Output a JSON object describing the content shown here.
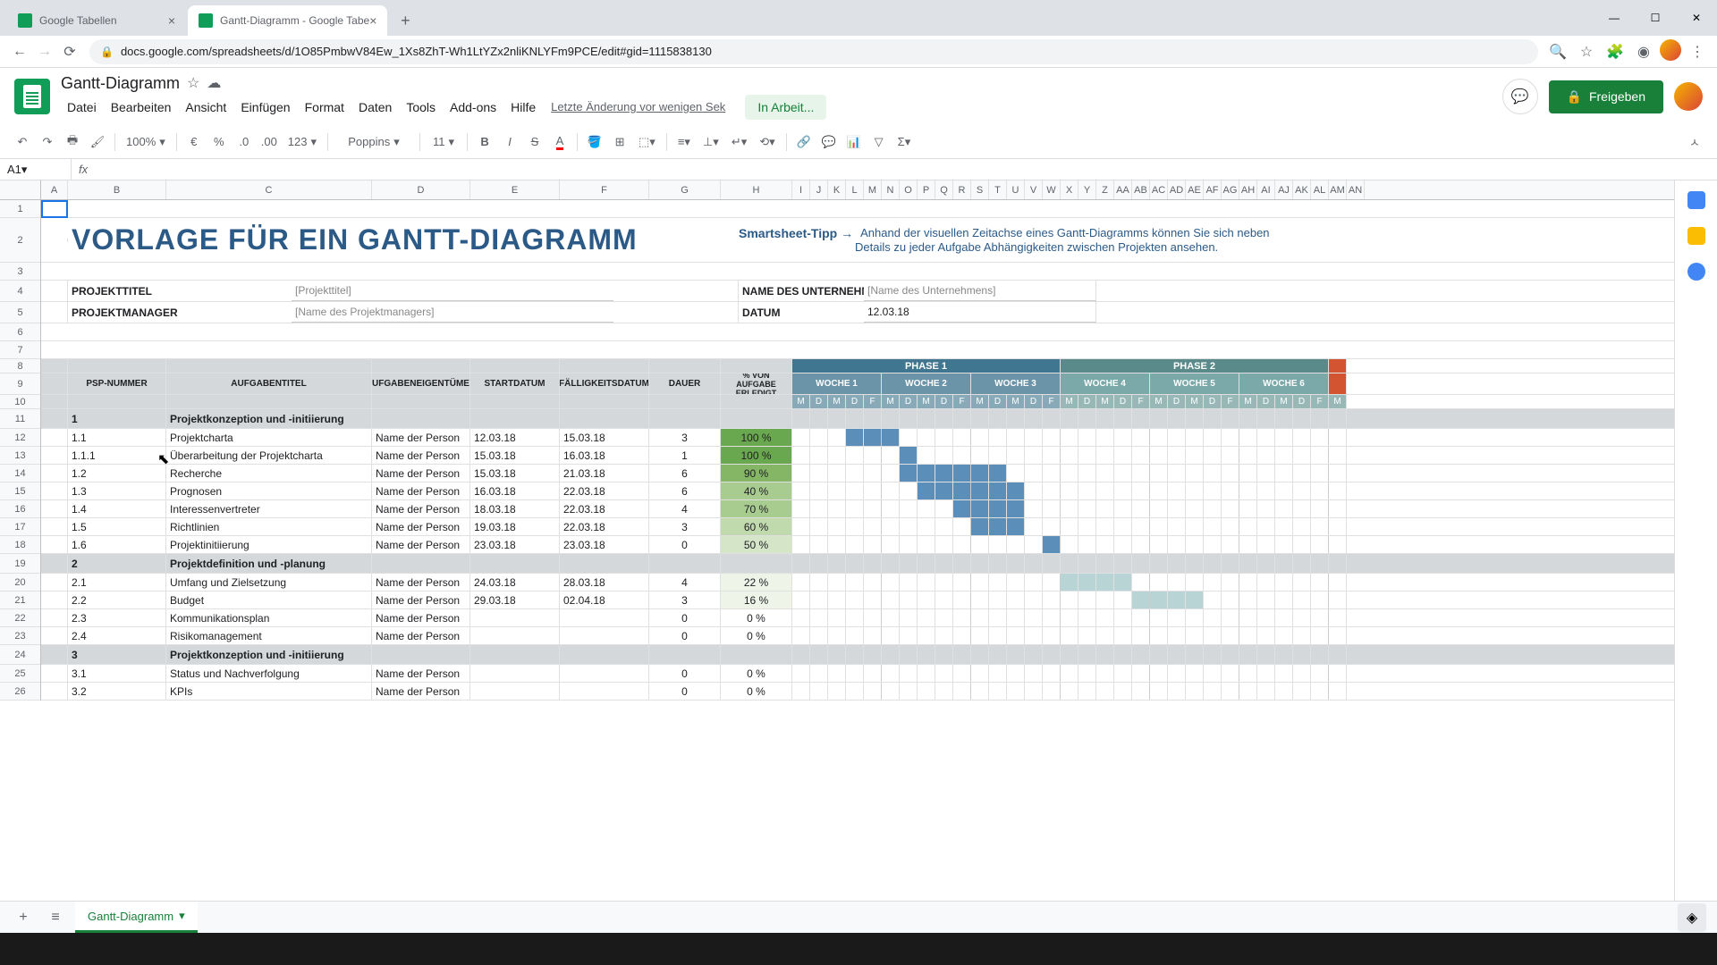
{
  "browser": {
    "tabs": [
      {
        "title": "Google Tabellen",
        "active": false
      },
      {
        "title": "Gantt-Diagramm - Google Tabe",
        "active": true
      }
    ],
    "url": "docs.google.com/spreadsheets/d/1O85PmbwV84Ew_1Xs8ZhT-Wh1LtYZx2nliKNLYFm9PCE/edit#gid=1115838130"
  },
  "doc": {
    "title": "Gantt-Diagramm",
    "menus": [
      "Datei",
      "Bearbeiten",
      "Ansicht",
      "Einfügen",
      "Format",
      "Daten",
      "Tools",
      "Add-ons",
      "Hilfe"
    ],
    "last_edit": "Letzte Änderung vor wenigen Sek",
    "working": "In Arbeit...",
    "share": "Freigeben"
  },
  "toolbar": {
    "zoom": "100%",
    "currency": "€",
    "pct": "%",
    "dec_less": ".0",
    "dec_more": ".00",
    "num_fmt": "123",
    "font": "Poppins",
    "size": "11"
  },
  "formula": {
    "cell_ref": "A1"
  },
  "cols": {
    "A": 30,
    "B": 110,
    "C": 230,
    "D": 110,
    "E": 100,
    "F": 100,
    "G": 80,
    "H": 80
  },
  "day_cols": [
    "M",
    "D",
    "M",
    "D",
    "F",
    "M",
    "D",
    "M",
    "D",
    "F",
    "M",
    "D",
    "M",
    "D",
    "F",
    "M",
    "D",
    "M",
    "D",
    "F",
    "M",
    "D",
    "M",
    "D",
    "F",
    "M",
    "D",
    "M",
    "D",
    "F",
    "M"
  ],
  "content": {
    "title": "VORLAGE FÜR EIN GANTT-DIAGRAMM",
    "tip_label": "Smartsheet-Tipp →",
    "tip_text1": "Anhand der visuellen Zeitachse eines Gantt-Diagramms können Sie sich neben",
    "tip_text2": "Details zu jeder Aufgabe Abhängigkeiten zwischen Projekten ansehen.",
    "meta": {
      "project_title_label": "PROJEKTTITEL",
      "project_title_value": "[Projekttitel]",
      "company_label": "NAME DES UNTERNEHMEN",
      "company_value": "[Name des Unternehmens]",
      "manager_label": "PROJEKTMANAGER",
      "manager_value": "[Name des Projektmanagers]",
      "date_label": "DATUM",
      "date_value": "12.03.18"
    },
    "headers": {
      "psp": "PSP-NUMMER",
      "task": "AUFGABENTITEL",
      "owner": "AUFGABENEIGENTÜMER",
      "start": "STARTDATUM",
      "due": "FÄLLIGKEITSDATUM",
      "duration": "DAUER",
      "pct": "% VON AUFGABE ERLEDIGT",
      "phase1": "PHASE 1",
      "phase2": "PHASE 2",
      "weeks": [
        "WOCHE 1",
        "WOCHE 2",
        "WOCHE 3",
        "WOCHE 4",
        "WOCHE 5",
        "WOCHE 6"
      ]
    },
    "sections": [
      {
        "num": "1",
        "title": "Projektkonzeption und -initiierung"
      },
      {
        "num": "2",
        "title": "Projektdefinition und -planung"
      },
      {
        "num": "3",
        "title": "Projektkonzeption und -initiierung"
      }
    ],
    "tasks1": [
      {
        "num": "1.1",
        "title": "Projektcharta",
        "owner": "Name der Person",
        "start": "12.03.18",
        "due": "15.03.18",
        "dur": "3",
        "pct": "100 %",
        "pcls": "pct-100",
        "gstart": 3,
        "glen": 3
      },
      {
        "num": "1.1.1",
        "title": "Überarbeitung der Projektcharta",
        "owner": "Name der Person",
        "start": "15.03.18",
        "due": "16.03.18",
        "dur": "1",
        "pct": "100 %",
        "pcls": "pct-100",
        "gstart": 6,
        "glen": 1
      },
      {
        "num": "1.2",
        "title": "Recherche",
        "owner": "Name der Person",
        "start": "15.03.18",
        "due": "21.03.18",
        "dur": "6",
        "pct": "90 %",
        "pcls": "pct-90",
        "gstart": 6,
        "glen": 6
      },
      {
        "num": "1.3",
        "title": "Prognosen",
        "owner": "Name der Person",
        "start": "16.03.18",
        "due": "22.03.18",
        "dur": "6",
        "pct": "40 %",
        "pcls": "pct-70",
        "gstart": 7,
        "glen": 6
      },
      {
        "num": "1.4",
        "title": "Interessenvertreter",
        "owner": "Name der Person",
        "start": "18.03.18",
        "due": "22.03.18",
        "dur": "4",
        "pct": "70 %",
        "pcls": "pct-70",
        "gstart": 9,
        "glen": 4
      },
      {
        "num": "1.5",
        "title": "Richtlinien",
        "owner": "Name der Person",
        "start": "19.03.18",
        "due": "22.03.18",
        "dur": "3",
        "pct": "60 %",
        "pcls": "pct-60",
        "gstart": 10,
        "glen": 3
      },
      {
        "num": "1.6",
        "title": "Projektinitiierung",
        "owner": "Name der Person",
        "start": "23.03.18",
        "due": "23.03.18",
        "dur": "0",
        "pct": "50 %",
        "pcls": "pct-50",
        "gstart": 14,
        "glen": 1
      }
    ],
    "tasks2": [
      {
        "num": "2.1",
        "title": "Umfang und Zielsetzung",
        "owner": "Name der Person",
        "start": "24.03.18",
        "due": "28.03.18",
        "dur": "4",
        "pct": "22 %",
        "pcls": "pct-low",
        "gstart": 15,
        "glen": 4,
        "p2": true
      },
      {
        "num": "2.2",
        "title": "Budget",
        "owner": "Name der Person",
        "start": "29.03.18",
        "due": "02.04.18",
        "dur": "3",
        "pct": "16 %",
        "pcls": "pct-low",
        "gstart": 19,
        "glen": 4,
        "p2": true
      },
      {
        "num": "2.3",
        "title": "Kommunikationsplan",
        "owner": "Name der Person",
        "start": "",
        "due": "",
        "dur": "0",
        "pct": "0 %",
        "pcls": ""
      },
      {
        "num": "2.4",
        "title": "Risikomanagement",
        "owner": "Name der Person",
        "start": "",
        "due": "",
        "dur": "0",
        "pct": "0 %",
        "pcls": ""
      }
    ],
    "tasks3": [
      {
        "num": "3.1",
        "title": "Status und Nachverfolgung",
        "owner": "Name der Person",
        "start": "",
        "due": "",
        "dur": "0",
        "pct": "0 %",
        "pcls": ""
      },
      {
        "num": "3.2",
        "title": "KPIs",
        "owner": "Name der Person",
        "start": "",
        "due": "",
        "dur": "0",
        "pct": "0 %",
        "pcls": ""
      }
    ]
  },
  "sheet_tab": "Gantt-Diagramm",
  "row_nums": [
    "1",
    "2",
    "3",
    "4",
    "5",
    "6",
    "7",
    "8",
    "9",
    "10",
    "11",
    "12",
    "13",
    "14",
    "15",
    "16",
    "17",
    "18",
    "19",
    "20",
    "21",
    "22",
    "23",
    "24",
    "25",
    "26"
  ]
}
